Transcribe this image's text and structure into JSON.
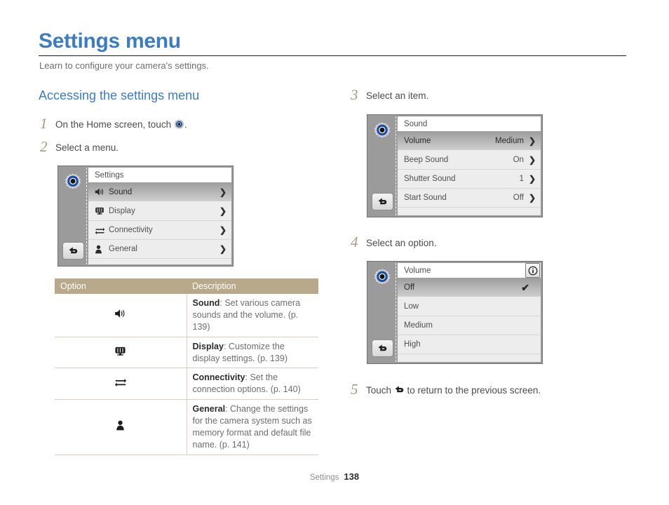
{
  "page": {
    "title": "Settings menu",
    "subtitle": "Learn to configure your camera's settings.",
    "section_heading": "Accessing the settings menu",
    "footer_label": "Settings",
    "footer_page": "138",
    "accent_color": "#3b7cc4",
    "step_number_color": "#a99b80",
    "table_header_color": "#b8a98b"
  },
  "steps": {
    "one": {
      "num": "1",
      "text_before": "On the Home screen, touch ",
      "icon": "settings-gear-icon",
      "text_after": "."
    },
    "two": {
      "num": "2",
      "text": "Select a menu."
    },
    "three": {
      "num": "3",
      "text": "Select an item."
    },
    "four": {
      "num": "4",
      "text": "Select an option."
    },
    "five": {
      "num": "5",
      "text_before": "Touch ",
      "icon": "back-arrow-icon",
      "text_after": " to return to the previous screen."
    }
  },
  "screen_settings": {
    "title": "Settings",
    "side_icon": "settings-gear-icon",
    "back_icon": "back-arrow-icon",
    "rows": [
      {
        "icon": "speaker-icon",
        "label": "Sound",
        "value": "",
        "chevron": "❯",
        "selected": true
      },
      {
        "icon": "display-icon",
        "label": "Display",
        "value": "",
        "chevron": "❯",
        "selected": false
      },
      {
        "icon": "connectivity-icon",
        "label": "Connectivity",
        "value": "",
        "chevron": "❯",
        "selected": false
      },
      {
        "icon": "general-person-icon",
        "label": "General",
        "value": "",
        "chevron": "❯",
        "selected": false
      }
    ]
  },
  "screen_sound": {
    "title": "Sound",
    "side_icon": "settings-gear-icon",
    "back_icon": "back-arrow-icon",
    "rows": [
      {
        "label": "Volume",
        "value": "Medium",
        "chevron": "❯",
        "selected": true
      },
      {
        "label": "Beep Sound",
        "value": "On",
        "chevron": "❯",
        "selected": false
      },
      {
        "label": "Shutter Sound",
        "value": "1",
        "chevron": "❯",
        "selected": false
      },
      {
        "label": "Start Sound",
        "value": "Off",
        "chevron": "❯",
        "selected": false
      }
    ]
  },
  "screen_volume": {
    "title": "Volume",
    "side_icon": "settings-gear-icon",
    "back_icon": "back-arrow-icon",
    "info_icon": "info-icon",
    "rows": [
      {
        "label": "Off",
        "check": "✔",
        "selected": true
      },
      {
        "label": "Low",
        "check": "",
        "selected": false
      },
      {
        "label": "Medium",
        "check": "",
        "selected": false
      },
      {
        "label": "High",
        "check": "",
        "selected": false
      }
    ]
  },
  "option_table": {
    "headers": [
      "Option",
      "Description"
    ],
    "rows": [
      {
        "icon": "speaker-icon",
        "term": "Sound",
        "desc": ": Set various camera sounds and the volume. (p. 139)"
      },
      {
        "icon": "display-icon",
        "term": "Display",
        "desc": ": Customize the display settings. (p. 139)"
      },
      {
        "icon": "connectivity-icon",
        "term": "Connectivity",
        "desc": ": Set the connection options. (p. 140)"
      },
      {
        "icon": "general-person-icon",
        "term": "General",
        "desc": ": Change the settings for the camera system such as memory format and default file name. (p. 141)"
      }
    ]
  }
}
